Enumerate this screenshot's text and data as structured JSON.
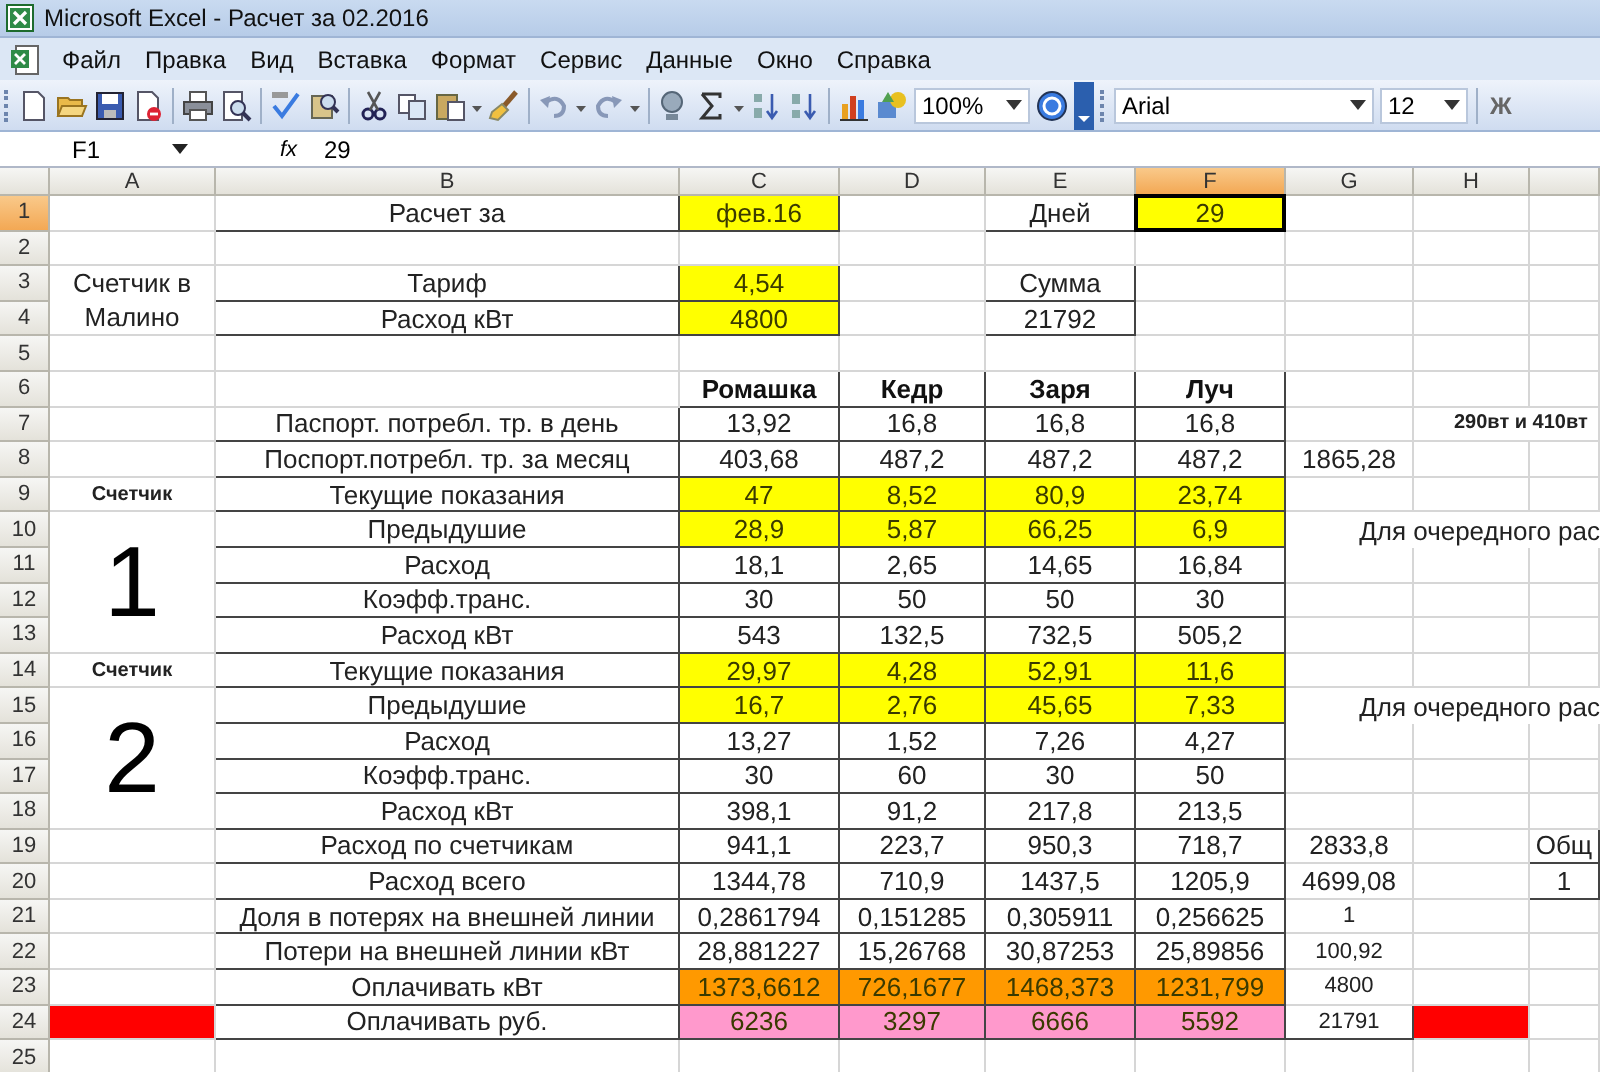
{
  "window": {
    "title": "Microsoft Excel - Расчет за 02.2016"
  },
  "menu": [
    "Файл",
    "Правка",
    "Вид",
    "Вставка",
    "Формат",
    "Сервис",
    "Данные",
    "Окно",
    "Справка"
  ],
  "toolbar": {
    "zoom": "100%",
    "font": "Arial",
    "font_size": "12",
    "bold_key": "Ж"
  },
  "formula_bar": {
    "name_box": "F1",
    "fx": "fx",
    "formula": "29"
  },
  "sheet": {
    "columns": [
      {
        "label": "A",
        "selected": false
      },
      {
        "label": "B",
        "selected": false
      },
      {
        "label": "C",
        "selected": false
      },
      {
        "label": "D",
        "selected": false
      },
      {
        "label": "E",
        "selected": false
      },
      {
        "label": "F",
        "selected": true
      },
      {
        "label": "G",
        "selected": false
      },
      {
        "label": "H",
        "selected": false
      }
    ],
    "rows": [
      {
        "number": "1",
        "selected": true,
        "cells": {
          "B": {
            "text": "Расчет за",
            "boxed": true
          },
          "C": {
            "text": "фев.16",
            "color": "#ffff00",
            "boxed": true
          },
          "E": {
            "text": "Дней",
            "boxed": true
          },
          "F": {
            "text": "29",
            "color": "#ffff00",
            "boxed": true
          }
        }
      },
      {
        "number": "2",
        "selected": false,
        "cells": {}
      },
      {
        "number": "3",
        "selected": false,
        "cells": {
          "A": {
            "text": "Счетчик в Малино",
            "kind": "wrapped"
          },
          "B": {
            "text": "Тариф",
            "boxed": true
          },
          "C": {
            "text": "4,54",
            "color": "#ffff00",
            "boxed": true
          },
          "E": {
            "text": "Сумма",
            "boxed": true
          }
        }
      },
      {
        "number": "4",
        "selected": false,
        "cells": {
          "B": {
            "text": "Расход кВт",
            "boxed": true
          },
          "C": {
            "text": "4800",
            "color": "#ffff00",
            "boxed": true
          },
          "E": {
            "text": "21792",
            "boxed": true
          }
        }
      },
      {
        "number": "5",
        "selected": false,
        "cells": {}
      },
      {
        "number": "6",
        "selected": false,
        "cells": {
          "C": {
            "text": "Ромашка",
            "kind": "heading",
            "boxed": true
          },
          "D": {
            "text": "Кедр",
            "kind": "heading",
            "boxed": true
          },
          "E": {
            "text": "Заря",
            "kind": "heading",
            "boxed": true
          },
          "F": {
            "text": "Луч",
            "kind": "heading",
            "boxed": true
          }
        }
      },
      {
        "number": "7",
        "selected": false,
        "cells": {
          "B": {
            "text": "Паспорт. потребл. тр. в день",
            "boxed": true
          },
          "C": {
            "text": "13,92",
            "boxed": true
          },
          "D": {
            "text": "16,8",
            "boxed": true
          },
          "E": {
            "text": "16,8",
            "boxed": true
          },
          "F": {
            "text": "16,8",
            "boxed": true
          },
          "H": {
            "text": "290вт и 410вт",
            "kind": "note"
          }
        }
      },
      {
        "number": "8",
        "selected": false,
        "cells": {
          "B": {
            "text": "Поспорт.потребл. тр. за месяц",
            "boxed": true
          },
          "C": {
            "text": "403,68",
            "boxed": true
          },
          "D": {
            "text": "487,2",
            "boxed": true
          },
          "E": {
            "text": "487,2",
            "boxed": true
          },
          "F": {
            "text": "487,2",
            "boxed": true
          },
          "G": {
            "text": "1865,28"
          }
        }
      },
      {
        "number": "9",
        "selected": false,
        "cells": {
          "A": {
            "text": "Счетчик",
            "kind": "caption"
          },
          "B": {
            "text": "Текущие показания",
            "boxed": true
          },
          "C": {
            "text": "47",
            "color": "#ffff00",
            "boxed": true
          },
          "D": {
            "text": "8,52",
            "color": "#ffff00",
            "boxed": true
          },
          "E": {
            "text": "80,9",
            "color": "#ffff00",
            "boxed": true
          },
          "F": {
            "text": "23,74",
            "color": "#ffff00",
            "boxed": true
          }
        }
      },
      {
        "number": "10",
        "selected": false,
        "cells": {
          "A": {
            "text": "1",
            "kind": "digit"
          },
          "B": {
            "text": "Предыдушие",
            "boxed": true
          },
          "C": {
            "text": "28,9",
            "color": "#ffff00",
            "boxed": true
          },
          "D": {
            "text": "5,87",
            "color": "#ffff00",
            "boxed": true
          },
          "E": {
            "text": "66,25",
            "color": "#ffff00",
            "boxed": true
          },
          "F": {
            "text": "6,9",
            "color": "#ffff00",
            "boxed": true
          },
          "G": {
            "text": "Для очередного рас",
            "kind": "overflow"
          }
        }
      },
      {
        "number": "11",
        "selected": false,
        "cells": {
          "B": {
            "text": "Расход",
            "boxed": true
          },
          "C": {
            "text": "18,1",
            "boxed": true
          },
          "D": {
            "text": "2,65",
            "boxed": true
          },
          "E": {
            "text": "14,65",
            "boxed": true
          },
          "F": {
            "text": "16,84",
            "boxed": true
          }
        }
      },
      {
        "number": "12",
        "selected": false,
        "cells": {
          "B": {
            "text": "Коэфф.транс.",
            "boxed": true
          },
          "C": {
            "text": "30",
            "boxed": true
          },
          "D": {
            "text": "50",
            "boxed": true
          },
          "E": {
            "text": "50",
            "boxed": true
          },
          "F": {
            "text": "30",
            "boxed": true
          }
        }
      },
      {
        "number": "13",
        "selected": false,
        "cells": {
          "B": {
            "text": "Расход кВт",
            "boxed": true
          },
          "C": {
            "text": "543",
            "boxed": true
          },
          "D": {
            "text": "132,5",
            "boxed": true
          },
          "E": {
            "text": "732,5",
            "boxed": true
          },
          "F": {
            "text": "505,2",
            "boxed": true
          }
        }
      },
      {
        "number": "14",
        "selected": false,
        "cells": {
          "A": {
            "text": "Счетчик",
            "kind": "caption"
          },
          "B": {
            "text": "Текущие показания",
            "boxed": true
          },
          "C": {
            "text": "29,97",
            "color": "#ffff00",
            "boxed": true
          },
          "D": {
            "text": "4,28",
            "color": "#ffff00",
            "boxed": true
          },
          "E": {
            "text": "52,91",
            "color": "#ffff00",
            "boxed": true
          },
          "F": {
            "text": "11,6",
            "color": "#ffff00",
            "boxed": true
          }
        }
      },
      {
        "number": "15",
        "selected": false,
        "cells": {
          "A": {
            "text": "2",
            "kind": "digit"
          },
          "B": {
            "text": "Предыдушие",
            "boxed": true
          },
          "C": {
            "text": "16,7",
            "color": "#ffff00",
            "boxed": true
          },
          "D": {
            "text": "2,76",
            "color": "#ffff00",
            "boxed": true
          },
          "E": {
            "text": "45,65",
            "color": "#ffff00",
            "boxed": true
          },
          "F": {
            "text": "7,33",
            "color": "#ffff00",
            "boxed": true
          },
          "G": {
            "text": "Для очередного рас",
            "kind": "overflow"
          }
        }
      },
      {
        "number": "16",
        "selected": false,
        "cells": {
          "B": {
            "text": "Расход",
            "boxed": true
          },
          "C": {
            "text": "13,27",
            "boxed": true
          },
          "D": {
            "text": "1,52",
            "boxed": true
          },
          "E": {
            "text": "7,26",
            "boxed": true
          },
          "F": {
            "text": "4,27",
            "boxed": true
          }
        }
      },
      {
        "number": "17",
        "selected": false,
        "cells": {
          "B": {
            "text": "Коэфф.транс.",
            "boxed": true
          },
          "C": {
            "text": "30",
            "boxed": true
          },
          "D": {
            "text": "60",
            "boxed": true
          },
          "E": {
            "text": "30",
            "boxed": true
          },
          "F": {
            "text": "50",
            "boxed": true
          }
        }
      },
      {
        "number": "18",
        "selected": false,
        "cells": {
          "B": {
            "text": "Расход кВт",
            "boxed": true
          },
          "C": {
            "text": "398,1",
            "boxed": true
          },
          "D": {
            "text": "91,2",
            "boxed": true
          },
          "E": {
            "text": "217,8",
            "boxed": true
          },
          "F": {
            "text": "213,5",
            "boxed": true
          }
        }
      },
      {
        "number": "19",
        "selected": false,
        "cells": {
          "B": {
            "text": "Расход по счетчикам",
            "boxed": true
          },
          "C": {
            "text": "941,1",
            "boxed": true
          },
          "D": {
            "text": "223,7",
            "boxed": true
          },
          "E": {
            "text": "950,3",
            "boxed": true
          },
          "F": {
            "text": "718,7",
            "boxed": true
          },
          "G": {
            "text": "2833,8"
          },
          "I": {
            "text": "Общ",
            "boxed": true
          }
        }
      },
      {
        "number": "20",
        "selected": false,
        "cells": {
          "B": {
            "text": "Расход всего",
            "boxed": true
          },
          "C": {
            "text": "1344,78",
            "boxed": true
          },
          "D": {
            "text": "710,9",
            "boxed": true
          },
          "E": {
            "text": "1437,5",
            "boxed": true
          },
          "F": {
            "text": "1205,9",
            "boxed": true
          },
          "G": {
            "text": "4699,08"
          },
          "I": {
            "text": "1",
            "boxed": true
          }
        }
      },
      {
        "number": "21",
        "selected": false,
        "cells": {
          "B": {
            "text": "Доля в потерях на внешней линии",
            "boxed": true
          },
          "C": {
            "text": "0,2861794",
            "boxed": true
          },
          "D": {
            "text": "0,151285",
            "boxed": true
          },
          "E": {
            "text": "0,305911",
            "boxed": true
          },
          "F": {
            "text": "0,256625",
            "boxed": true
          },
          "G": {
            "text": "1",
            "kind": "small"
          }
        }
      },
      {
        "number": "22",
        "selected": false,
        "cells": {
          "B": {
            "text": "Потери на внешней линии кВт",
            "boxed": true
          },
          "C": {
            "text": "28,881227",
            "boxed": true
          },
          "D": {
            "text": "15,26768",
            "boxed": true
          },
          "E": {
            "text": "30,87253",
            "boxed": true
          },
          "F": {
            "text": "25,89856",
            "boxed": true
          },
          "G": {
            "text": "100,92",
            "kind": "small"
          }
        }
      },
      {
        "number": "23",
        "selected": false,
        "cells": {
          "B": {
            "text": "Оплачивать кВт",
            "boxed": true
          },
          "C": {
            "text": "1373,6612",
            "color": "#ff9900",
            "boxed": true
          },
          "D": {
            "text": "726,1677",
            "color": "#ff9900",
            "boxed": true
          },
          "E": {
            "text": "1468,373",
            "color": "#ff9900",
            "boxed": true
          },
          "F": {
            "text": "1231,799",
            "color": "#ff9900",
            "boxed": true
          },
          "G": {
            "text": "4800",
            "kind": "small"
          }
        }
      },
      {
        "number": "24",
        "selected": false,
        "cells": {
          "A": {
            "color": "#ff0000"
          },
          "B": {
            "text": "Оплачивать руб.",
            "boxed": true
          },
          "C": {
            "text": "6236",
            "color": "#ff99cc",
            "boxed": true
          },
          "D": {
            "text": "3297",
            "color": "#ff99cc",
            "boxed": true
          },
          "E": {
            "text": "6666",
            "color": "#ff99cc",
            "boxed": true
          },
          "F": {
            "text": "5592",
            "color": "#ff99cc",
            "boxed": true
          },
          "G": {
            "text": "21791",
            "kind": "small",
            "boxed": true
          },
          "H": {
            "color": "#ff0000"
          }
        }
      },
      {
        "number": "25",
        "selected": false,
        "cells": {}
      }
    ]
  }
}
